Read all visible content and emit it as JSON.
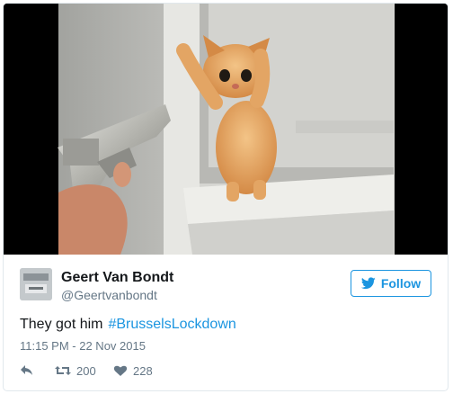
{
  "tweet": {
    "author": {
      "name": "Geert Van Bondt",
      "handle": "@Geertvanbondt"
    },
    "follow_label": "Follow",
    "text": "They got him",
    "hashtag": "#BrusselsLockdown",
    "timestamp": "11:15 PM - 22 Nov 2015",
    "actions": {
      "retweets": "200",
      "likes": "228"
    }
  },
  "icons": {
    "follow": "twitter-bird-icon",
    "reply": "reply-arrow-icon",
    "retweet": "retweet-icon",
    "like": "heart-icon"
  },
  "colors": {
    "accent": "#1b95e0",
    "muted": "#657786",
    "text": "#14171a",
    "border": "#e1e8ed"
  }
}
